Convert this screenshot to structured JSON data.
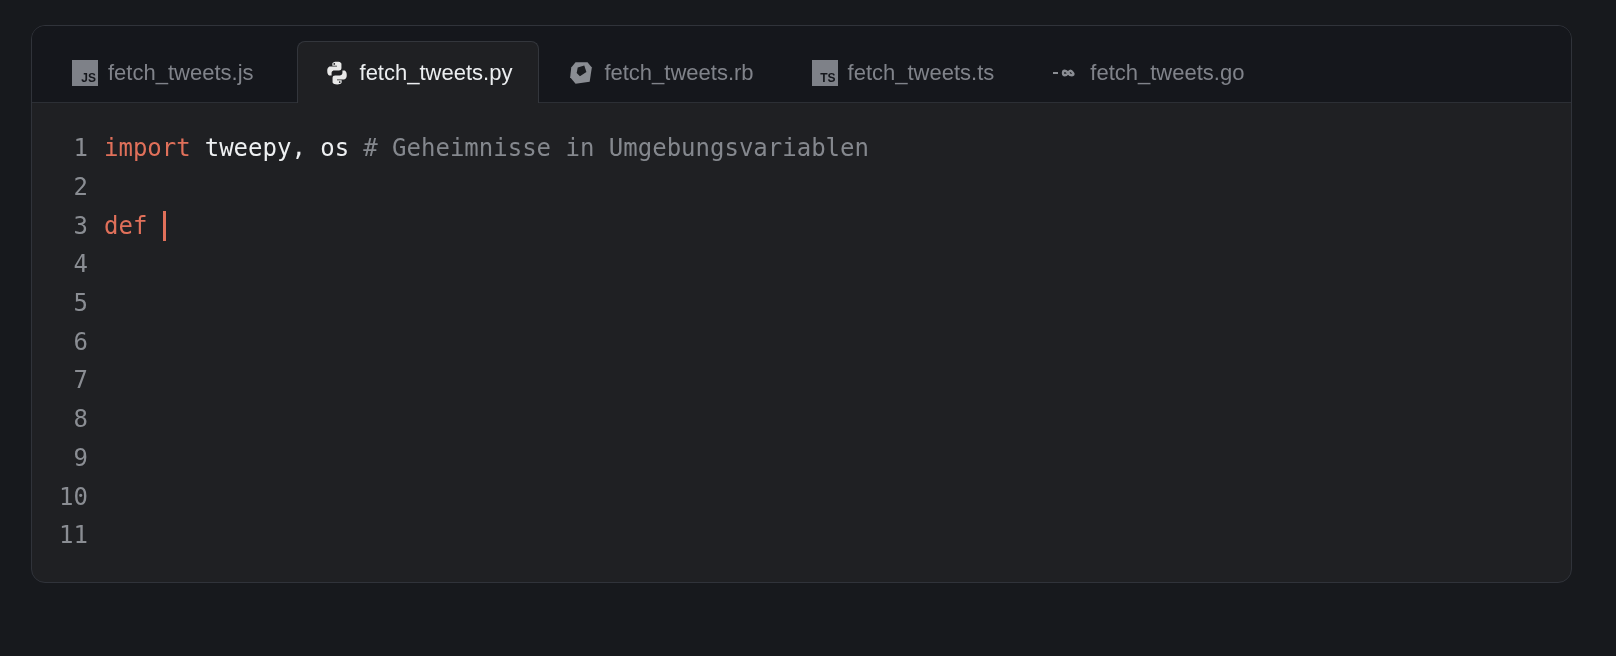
{
  "tabs": [
    {
      "label": "fetch_tweets.js",
      "badge": "JS",
      "selected": false
    },
    {
      "label": "fetch_tweets.py",
      "selected": true
    },
    {
      "label": "fetch_tweets.rb",
      "selected": false
    },
    {
      "label": "fetch_tweets.ts",
      "badge": "TS",
      "selected": false
    },
    {
      "label": "fetch_tweets.go",
      "selected": false
    }
  ],
  "editor": {
    "lines": [
      {
        "number": "1",
        "cursor": false,
        "tokens": [
          {
            "kind": "keyword",
            "text": "import"
          },
          {
            "kind": "plain",
            "text": "tweepy, os"
          },
          {
            "kind": "comment",
            "text": "# Geheimnisse in Umgebungsvariablen"
          }
        ]
      },
      {
        "number": "2",
        "cursor": false
      },
      {
        "number": "3",
        "cursor": true,
        "tokens": [
          {
            "kind": "keyword",
            "text": "def"
          }
        ]
      },
      {
        "number": "4",
        "cursor": false
      },
      {
        "number": "5",
        "cursor": false
      },
      {
        "number": "6",
        "cursor": false
      },
      {
        "number": "7",
        "cursor": false
      },
      {
        "number": "8",
        "cursor": false
      },
      {
        "number": "9",
        "cursor": false
      },
      {
        "number": "10",
        "cursor": false
      },
      {
        "number": "11",
        "cursor": false
      }
    ]
  }
}
